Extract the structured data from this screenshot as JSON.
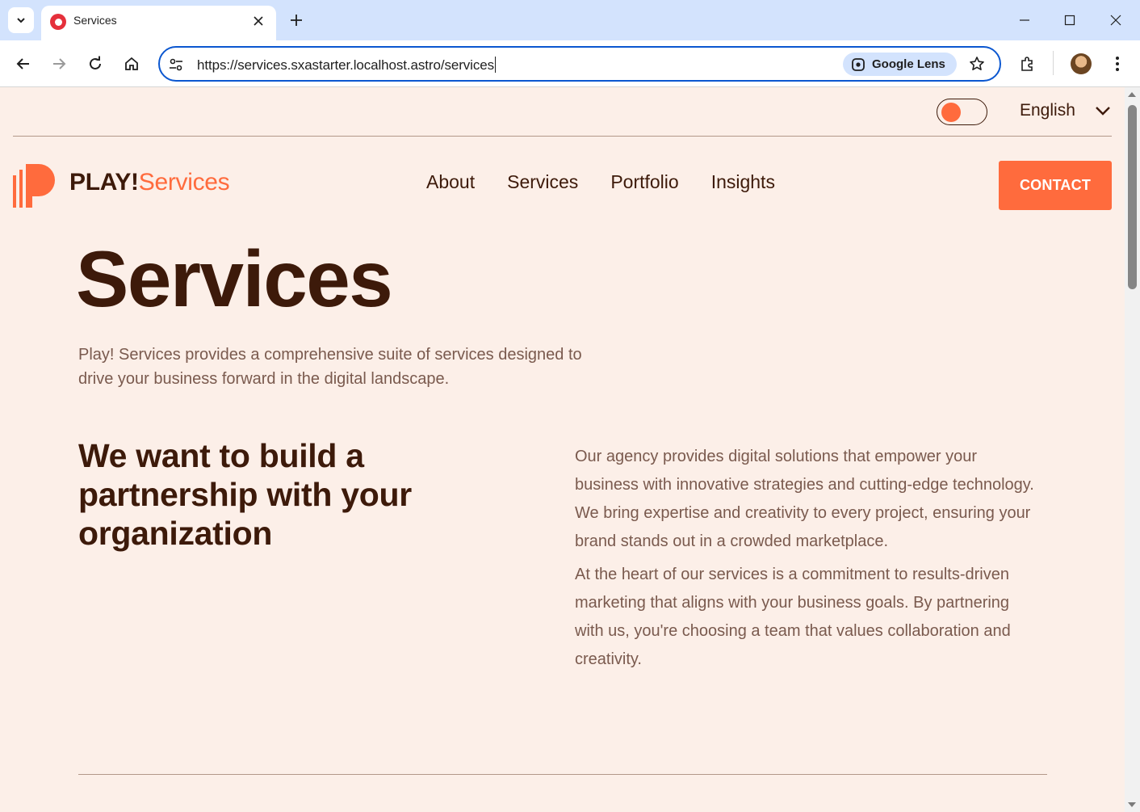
{
  "browser": {
    "tab_title": "Services",
    "url": "https://services.sxastarter.localhost.astro/services",
    "lens_label": "Google Lens"
  },
  "site": {
    "logo_main": "PLAY!",
    "logo_accent": "Services",
    "language": "English",
    "nav": [
      "About",
      "Services",
      "Portfolio",
      "Insights"
    ],
    "contact_label": "CONTACT",
    "accent_color": "#ff6b3d",
    "text_color": "#3d1a0a",
    "background_color": "#fcefe8"
  },
  "hero": {
    "title": "Services",
    "subtitle": "Play! Services provides a comprehensive suite of services designed to drive your business forward in the digital landscape."
  },
  "partnership": {
    "heading": "We want to build a partnership with your organization",
    "paragraph_1": "Our agency provides digital solutions that empower your business with innovative strategies and cutting-edge technology. We bring expertise and creativity to every project, ensuring your brand stands out in a crowded marketplace.",
    "paragraph_2": "At the heart of our services is a commitment to results-driven marketing that aligns with your business goals. By partnering with us, you're choosing a team that values collaboration and creativity."
  }
}
